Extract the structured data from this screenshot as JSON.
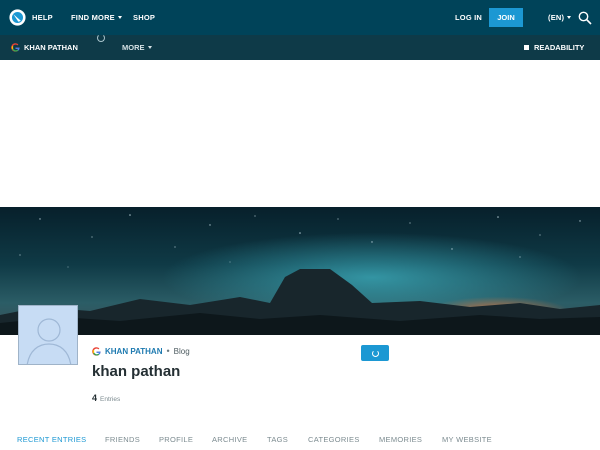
{
  "topbar": {
    "help": "HELP",
    "find_more": "FIND MORE",
    "shop": "SHOP",
    "login": "LOG IN",
    "join": "JOIN",
    "language": "(EN)"
  },
  "journalbar": {
    "username": "KHAN PATHAN",
    "more": "MORE",
    "readability": "READABILITY"
  },
  "profile": {
    "username": "KHAN PATHAN",
    "separator": "•",
    "type": "Blog",
    "title": "khan pathan",
    "entries_count": "4",
    "entries_label": "Entries"
  },
  "tabs": [
    {
      "label": "RECENT ENTRIES",
      "active": true
    },
    {
      "label": "FRIENDS",
      "active": false
    },
    {
      "label": "PROFILE",
      "active": false
    },
    {
      "label": "ARCHIVE",
      "active": false
    },
    {
      "label": "TAGS",
      "active": false
    },
    {
      "label": "CATEGORIES",
      "active": false
    },
    {
      "label": "MEMORIES",
      "active": false
    },
    {
      "label": "MY WEBSITE",
      "active": false
    }
  ],
  "colors": {
    "topbar_bg": "#004359",
    "journalbar_bg": "#0e3a48",
    "accent": "#1c98d3",
    "link": "#1e7ab0"
  },
  "icons": {
    "logo": "livejournal-logo-icon",
    "search": "search-icon",
    "google": "google-g-icon",
    "loading": "loading-spinner-icon",
    "refresh": "refresh-icon"
  }
}
